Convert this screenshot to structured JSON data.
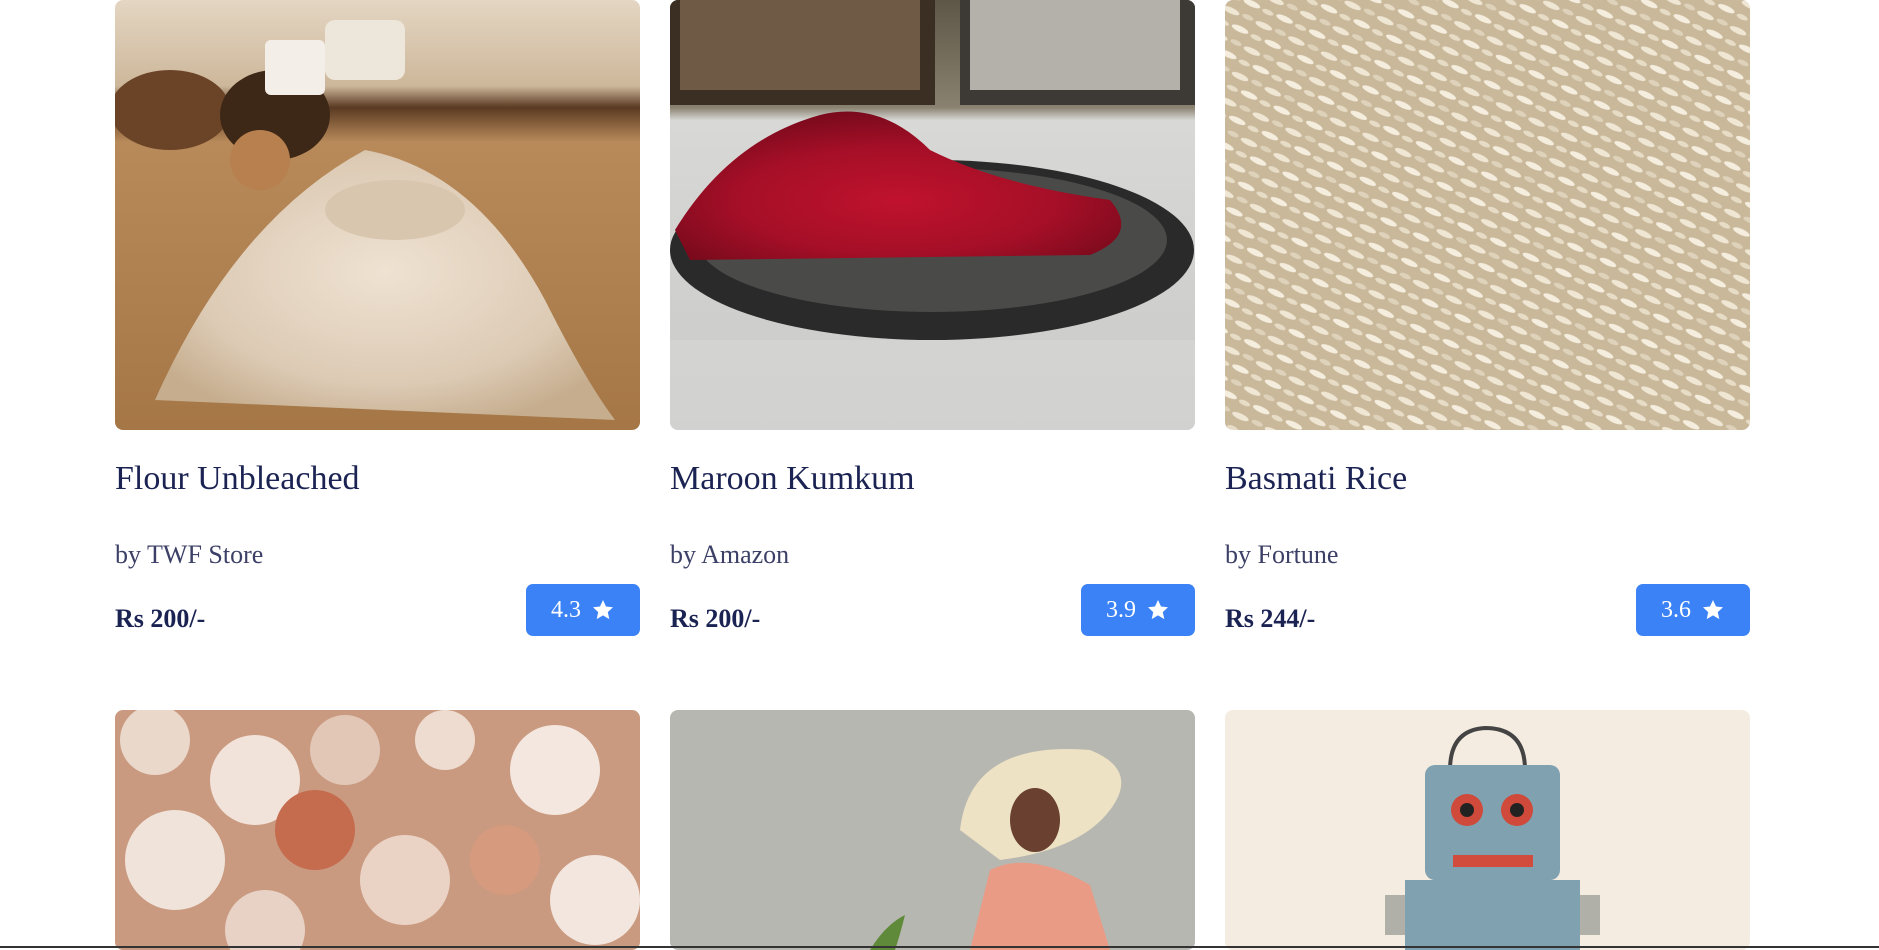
{
  "products": [
    {
      "title": "Flour Unbleached",
      "vendor": "by TWF Store",
      "price": "Rs 200/-",
      "rating": "4.3",
      "image": "flour-photo"
    },
    {
      "title": "Maroon Kumkum",
      "vendor": "by Amazon",
      "price": "Rs 200/-",
      "rating": "3.9",
      "image": "kumkum-photo"
    },
    {
      "title": "Basmati Rice",
      "vendor": "by Fortune",
      "price": "Rs 244/-",
      "rating": "3.6",
      "image": "rice-photo"
    }
  ],
  "next_row_images": [
    "salt-crystals-photo",
    "woman-in-hat-photo",
    "toy-robot-photo"
  ],
  "icons": {
    "rating": "star-icon"
  },
  "colors": {
    "accent": "#3b82f6",
    "title": "#1b2353"
  }
}
